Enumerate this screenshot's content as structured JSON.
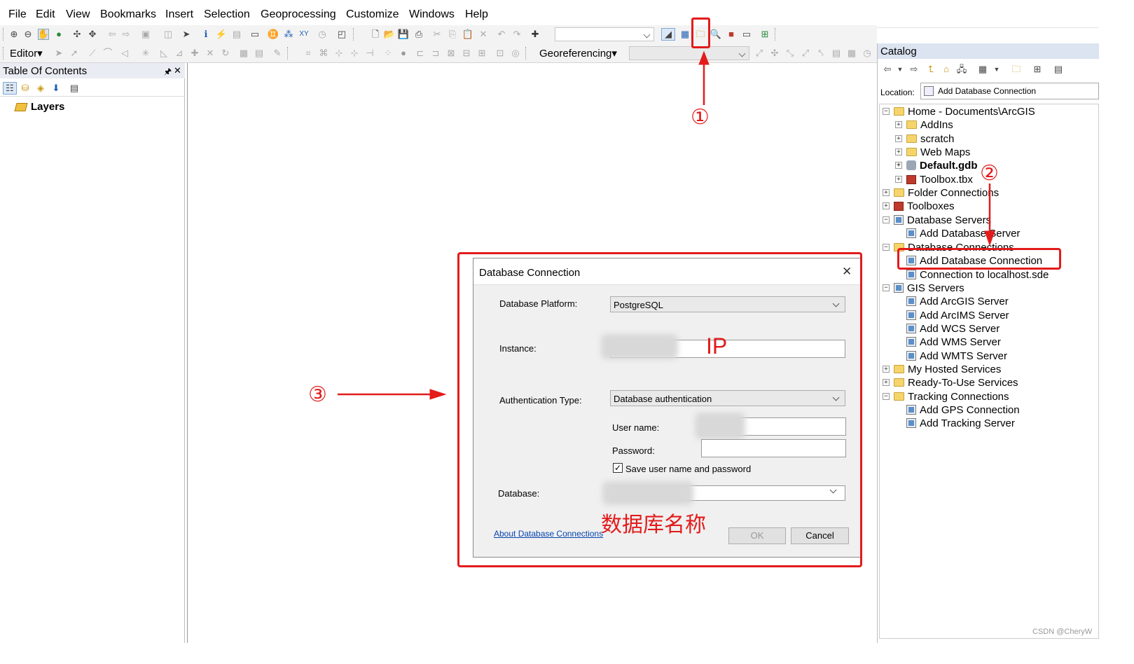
{
  "menu": [
    "File",
    "Edit",
    "View",
    "Bookmarks",
    "Insert",
    "Selection",
    "Geoprocessing",
    "Customize",
    "Windows",
    "Help"
  ],
  "toolbar2": {
    "editor": "Editor▾",
    "georef": "Georeferencing▾"
  },
  "toc": {
    "title": "Table Of Contents",
    "pin": "ᵖ",
    "close": "✕",
    "root": "Layers"
  },
  "catalog": {
    "title": "Catalog",
    "location_label": "Location:",
    "location_value": "Add Database Connection",
    "tree": [
      "Home - Documents\\ArcGIS",
      "AddIns",
      "scratch",
      "Web Maps",
      "Default.gdb",
      "Toolbox.tbx",
      "Folder Connections",
      "Toolboxes",
      "Database Servers",
      "Add Database Server",
      "Database Connections",
      "Add Database Connection",
      "Connection to localhost.sde",
      "GIS Servers",
      "Add ArcGIS Server",
      "Add ArcIMS Server",
      "Add WCS Server",
      "Add WMS Server",
      "Add WMTS Server",
      "My Hosted Services",
      "Ready-To-Use Services",
      "Tracking Connections",
      "Add GPS Connection",
      "Add Tracking Server"
    ]
  },
  "dialog": {
    "title": "Database Connection",
    "close": "✕",
    "platform_label": "Database Platform:",
    "platform_value": "PostgreSQL",
    "instance_label": "Instance:",
    "auth_label": "Authentication Type:",
    "auth_value": "Database authentication",
    "user_label": "User name:",
    "password_label": "Password:",
    "save_label": "Save user name and password",
    "save_checked": true,
    "database_label": "Database:",
    "about_link": "About Database Connections",
    "ok": "OK",
    "cancel": "Cancel"
  },
  "annotations": {
    "n1": "①",
    "n2": "②",
    "n3": "③",
    "ip": "IP",
    "dbname": "数据库名称",
    "color": "#e31b1b"
  },
  "watermark": "CSDN @CheryW"
}
